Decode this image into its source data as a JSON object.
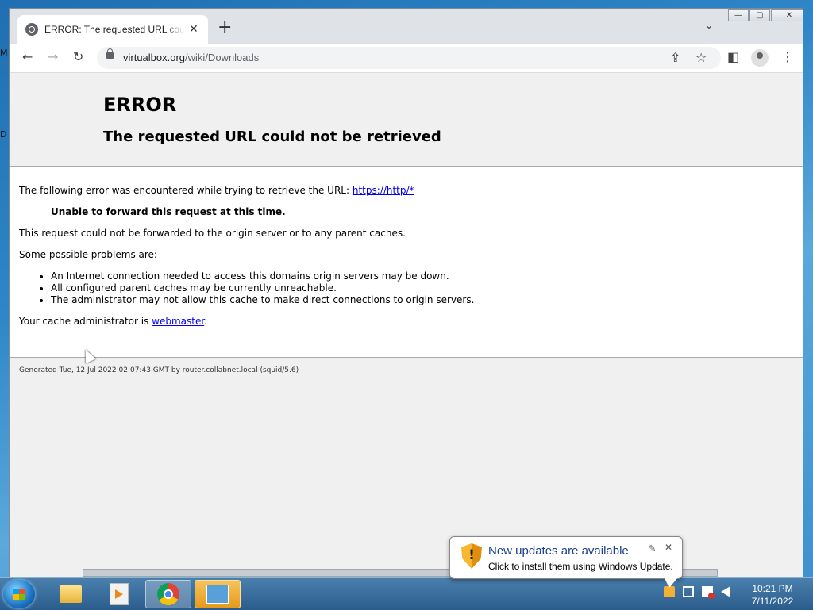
{
  "desktop": {
    "edge_letters": [
      "M",
      "D"
    ]
  },
  "browser": {
    "tab_title": "ERROR: The requested URL could not be retrieved",
    "tab_close": "✕",
    "new_tab": "+",
    "tab_menu": "⌄",
    "window_controls": {
      "minimize": "—",
      "maximize": "▢",
      "close": "✕"
    },
    "nav": {
      "back": "←",
      "forward": "→",
      "reload": "↻"
    },
    "url_host": "virtualbox.org",
    "url_path": "/wiki/Downloads",
    "actions": {
      "share": "⇪",
      "bookmark": "☆",
      "side_panel": "◧",
      "menu": "⋮"
    }
  },
  "page": {
    "h1": "ERROR",
    "h2": "The requested URL could not be retrieved",
    "intro": "The following error was encountered while trying to retrieve the URL: ",
    "intro_link": "https://http/*",
    "bold_message": "Unable to forward this request at this time.",
    "forward_msg": "This request could not be forwarded to the origin server or to any parent caches.",
    "problems_intro": "Some possible problems are:",
    "problems": [
      "An Internet connection needed to access this domains origin servers may be down.",
      "All configured parent caches may be currently unreachable.",
      "The administrator may not allow this cache to make direct connections to origin servers."
    ],
    "admin_prefix": "Your cache administrator is ",
    "admin_link": "webmaster",
    "admin_suffix": ".",
    "footer": "Generated Tue, 12 Jul 2022 02:07:43 GMT by router.collabnet.local (squid/5.6)"
  },
  "notification": {
    "title": "New updates are available",
    "text": "Click to install them using Windows Update.",
    "close": "✕",
    "pin": "✎"
  },
  "taskbar": {
    "clock_time": "10:21 PM",
    "clock_date": "7/11/2022",
    "tray_icons": [
      "network-icon",
      "flag-icon",
      "volume-icon"
    ]
  }
}
